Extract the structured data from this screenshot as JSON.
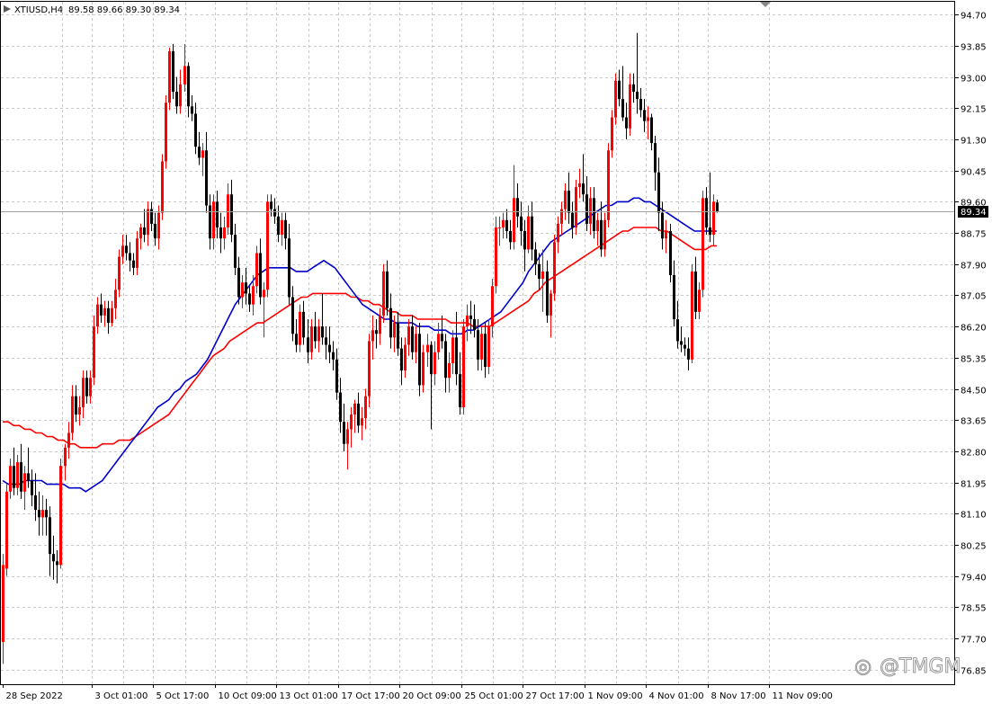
{
  "header": {
    "symbol": "XTIUSD,H4",
    "ohlc": "89.58 89.66 89.30 89.34"
  },
  "watermark": {
    "text": "@TMGM"
  },
  "colors": {
    "bull": "#ff0000",
    "bear": "#000000",
    "ma_fast": "#0000cc",
    "ma_slow": "#ff0000",
    "grid": "#c8c8c8",
    "price_marker_bg": "#000000",
    "price_marker_text": "#ffffff"
  },
  "chart_data": {
    "type": "candlestick",
    "symbol": "XTIUSD",
    "timeframe": "H4",
    "last_price": 89.34,
    "last_price_label": "89.34",
    "ylim": [
      76.45,
      95.05
    ],
    "grid": true,
    "y_ticks": [
      "94.70",
      "93.85",
      "93.00",
      "92.15",
      "91.30",
      "90.45",
      "89.60",
      "88.75",
      "87.90",
      "87.05",
      "86.20",
      "85.35",
      "84.50",
      "83.65",
      "82.80",
      "81.95",
      "81.10",
      "80.25",
      "79.40",
      "78.55",
      "77.70",
      "76.85"
    ],
    "x_ticks": [
      {
        "label": "28 Sep 2022",
        "index": 0
      },
      {
        "label": "3 Oct 01:00",
        "index": 17
      },
      {
        "label": "5 Oct 17:00",
        "index": 34
      },
      {
        "label": "10 Oct 09:00",
        "index": 51
      },
      {
        "label": "13 Oct 01:00",
        "index": 68
      },
      {
        "label": "17 Oct 17:00",
        "index": 85
      },
      {
        "label": "20 Oct 09:00",
        "index": 102
      },
      {
        "label": "25 Oct 01:00",
        "index": 119
      },
      {
        "label": "27 Oct 17:00",
        "index": 136
      },
      {
        "label": "1 Nov 09:00",
        "index": 153
      },
      {
        "label": "4 Nov 01:00",
        "index": 170
      },
      {
        "label": "8 Nov 17:00",
        "index": 187
      },
      {
        "label": "11 Nov 09:00",
        "index": 204
      }
    ],
    "ohlc": [
      [
        77.6,
        80.0,
        77.0,
        79.7
      ],
      [
        79.6,
        81.9,
        79.4,
        81.7
      ],
      [
        81.7,
        82.6,
        81.5,
        82.4
      ],
      [
        82.4,
        82.9,
        81.6,
        81.8
      ],
      [
        81.8,
        82.7,
        81.6,
        82.5
      ],
      [
        82.5,
        83.0,
        81.5,
        81.7
      ],
      [
        81.7,
        82.4,
        81.2,
        82.2
      ],
      [
        82.2,
        82.9,
        81.8,
        82.0
      ],
      [
        82.0,
        82.3,
        81.3,
        81.6
      ],
      [
        81.6,
        82.2,
        80.9,
        81.2
      ],
      [
        81.2,
        81.7,
        80.5,
        81.0
      ],
      [
        81.0,
        81.6,
        80.5,
        81.2
      ],
      [
        81.2,
        81.5,
        80.5,
        81.0
      ],
      [
        81.0,
        81.3,
        79.4,
        80.0
      ],
      [
        80.0,
        80.5,
        79.3,
        79.8
      ],
      [
        79.8,
        80.1,
        79.2,
        79.7
      ],
      [
        79.7,
        82.6,
        79.6,
        82.4
      ],
      [
        82.4,
        83.0,
        82.0,
        82.9
      ],
      [
        82.9,
        83.6,
        82.6,
        83.3
      ],
      [
        83.3,
        84.6,
        83.1,
        84.3
      ],
      [
        84.3,
        84.6,
        83.6,
        83.8
      ],
      [
        83.8,
        84.3,
        83.5,
        84.0
      ],
      [
        84.0,
        85.0,
        83.7,
        84.8
      ],
      [
        84.8,
        85.0,
        84.1,
        84.3
      ],
      [
        84.3,
        85.0,
        84.1,
        84.8
      ],
      [
        84.8,
        86.5,
        84.6,
        86.2
      ],
      [
        86.2,
        87.0,
        86.0,
        86.8
      ],
      [
        86.8,
        87.1,
        86.3,
        86.5
      ],
      [
        86.5,
        86.9,
        86.2,
        86.7
      ],
      [
        86.7,
        86.9,
        86.0,
        86.3
      ],
      [
        86.3,
        86.9,
        86.2,
        86.7
      ],
      [
        86.7,
        87.5,
        86.4,
        87.2
      ],
      [
        87.2,
        88.3,
        87.0,
        88.1
      ],
      [
        88.1,
        88.7,
        87.9,
        88.4
      ],
      [
        88.4,
        88.7,
        88.0,
        88.2
      ],
      [
        88.2,
        88.5,
        87.7,
        88.0
      ],
      [
        88.0,
        88.2,
        87.6,
        87.8
      ],
      [
        87.8,
        88.8,
        87.6,
        88.6
      ],
      [
        88.6,
        89.0,
        88.3,
        88.9
      ],
      [
        88.9,
        89.4,
        88.5,
        88.7
      ],
      [
        88.7,
        89.6,
        88.4,
        89.4
      ],
      [
        89.4,
        89.6,
        88.8,
        89.0
      ],
      [
        89.0,
        89.3,
        88.4,
        88.6
      ],
      [
        88.6,
        89.5,
        88.3,
        89.3
      ],
      [
        89.3,
        90.9,
        89.1,
        90.7
      ],
      [
        90.7,
        92.5,
        90.5,
        92.3
      ],
      [
        92.3,
        93.8,
        92.1,
        93.7
      ],
      [
        93.7,
        93.9,
        92.4,
        92.6
      ],
      [
        92.6,
        93.0,
        92.0,
        92.2
      ],
      [
        92.2,
        93.2,
        92.0,
        92.8
      ],
      [
        92.8,
        93.9,
        92.6,
        93.3
      ],
      [
        93.3,
        93.4,
        91.9,
        92.2
      ],
      [
        92.2,
        92.5,
        91.8,
        92.0
      ],
      [
        92.0,
        92.3,
        90.9,
        91.1
      ],
      [
        91.1,
        91.5,
        90.6,
        90.8
      ],
      [
        90.8,
        91.2,
        90.3,
        91.0
      ],
      [
        91.0,
        91.5,
        89.3,
        89.5
      ],
      [
        89.5,
        89.8,
        88.3,
        88.6
      ],
      [
        88.6,
        89.8,
        88.3,
        89.6
      ],
      [
        89.6,
        89.9,
        88.6,
        88.9
      ],
      [
        88.9,
        89.3,
        88.2,
        88.6
      ],
      [
        88.6,
        89.2,
        88.3,
        88.9
      ],
      [
        88.9,
        90.1,
        88.7,
        89.8
      ],
      [
        89.8,
        90.2,
        88.5,
        88.7
      ],
      [
        88.7,
        89.0,
        87.6,
        87.8
      ],
      [
        87.8,
        88.1,
        86.8,
        87.0
      ],
      [
        87.0,
        87.6,
        86.7,
        87.4
      ],
      [
        87.4,
        87.8,
        86.8,
        87.1
      ],
      [
        87.1,
        87.3,
        86.6,
        86.8
      ],
      [
        86.8,
        87.6,
        86.5,
        87.3
      ],
      [
        87.3,
        88.4,
        87.1,
        88.2
      ],
      [
        88.2,
        88.6,
        86.8,
        87.0
      ],
      [
        87.0,
        87.4,
        85.9,
        87.2
      ],
      [
        87.2,
        89.8,
        87.0,
        89.6
      ],
      [
        89.6,
        89.8,
        89.2,
        89.4
      ],
      [
        89.4,
        89.7,
        89.0,
        89.2
      ],
      [
        89.2,
        89.5,
        88.5,
        88.7
      ],
      [
        88.7,
        89.3,
        88.4,
        89.1
      ],
      [
        89.1,
        89.3,
        88.3,
        88.6
      ],
      [
        88.6,
        89.0,
        86.8,
        87.0
      ],
      [
        87.0,
        87.3,
        85.8,
        86.0
      ],
      [
        86.0,
        86.4,
        85.5,
        85.7
      ],
      [
        85.7,
        86.8,
        85.5,
        86.6
      ],
      [
        86.6,
        86.9,
        85.7,
        85.9
      ],
      [
        85.9,
        86.4,
        85.2,
        85.5
      ],
      [
        85.5,
        86.4,
        85.3,
        86.2
      ],
      [
        86.2,
        86.6,
        85.6,
        85.8
      ],
      [
        85.8,
        86.4,
        85.5,
        86.2
      ],
      [
        86.2,
        87.1,
        85.7,
        85.9
      ],
      [
        85.9,
        86.2,
        85.3,
        85.7
      ],
      [
        85.7,
        86.2,
        85.2,
        85.5
      ],
      [
        85.5,
        85.8,
        85.0,
        85.3
      ],
      [
        85.3,
        85.6,
        84.2,
        84.4
      ],
      [
        84.4,
        84.8,
        83.3,
        83.6
      ],
      [
        83.6,
        84.1,
        82.8,
        83.0
      ],
      [
        83.0,
        83.6,
        82.3,
        83.4
      ],
      [
        83.4,
        84.0,
        82.9,
        83.8
      ],
      [
        83.8,
        84.2,
        83.3,
        84.1
      ],
      [
        84.1,
        84.4,
        83.3,
        83.5
      ],
      [
        83.5,
        84.0,
        83.1,
        83.7
      ],
      [
        83.7,
        84.5,
        83.4,
        84.3
      ],
      [
        84.3,
        86.0,
        84.0,
        85.8
      ],
      [
        85.8,
        86.5,
        85.3,
        86.1
      ],
      [
        86.1,
        86.4,
        85.6,
        86.0
      ],
      [
        86.0,
        86.7,
        85.7,
        86.5
      ],
      [
        86.5,
        87.9,
        86.3,
        87.7
      ],
      [
        87.7,
        88.0,
        86.5,
        86.7
      ],
      [
        86.7,
        87.1,
        85.6,
        85.9
      ],
      [
        85.9,
        86.5,
        85.5,
        86.3
      ],
      [
        86.3,
        86.6,
        85.4,
        85.6
      ],
      [
        85.6,
        85.9,
        84.6,
        85.0
      ],
      [
        85.0,
        85.9,
        84.8,
        85.7
      ],
      [
        85.7,
        86.4,
        85.4,
        86.2
      ],
      [
        86.2,
        86.5,
        85.3,
        85.5
      ],
      [
        85.5,
        86.2,
        85.2,
        86.0
      ],
      [
        86.0,
        86.3,
        84.3,
        84.6
      ],
      [
        84.6,
        85.7,
        84.4,
        85.5
      ],
      [
        85.5,
        86.0,
        85.1,
        85.7
      ],
      [
        85.7,
        85.8,
        83.4,
        84.9
      ],
      [
        84.9,
        85.8,
        84.6,
        85.5
      ],
      [
        85.5,
        86.3,
        85.3,
        86.0
      ],
      [
        86.0,
        86.5,
        85.6,
        85.8
      ],
      [
        85.8,
        86.0,
        84.4,
        84.8
      ],
      [
        84.8,
        85.5,
        84.4,
        85.2
      ],
      [
        85.2,
        86.1,
        84.9,
        85.9
      ],
      [
        85.9,
        86.6,
        84.6,
        84.9
      ],
      [
        84.9,
        85.5,
        83.8,
        84.0
      ],
      [
        84.0,
        86.4,
        83.8,
        86.2
      ],
      [
        86.2,
        86.8,
        85.8,
        86.5
      ],
      [
        86.5,
        86.9,
        86.0,
        86.4
      ],
      [
        86.4,
        86.8,
        85.9,
        86.1
      ],
      [
        86.1,
        86.4,
        85.0,
        85.3
      ],
      [
        85.3,
        86.2,
        85.0,
        86.0
      ],
      [
        86.0,
        86.3,
        84.8,
        85.1
      ],
      [
        85.1,
        86.4,
        84.9,
        86.2
      ],
      [
        86.2,
        87.5,
        85.9,
        87.3
      ],
      [
        87.3,
        89.2,
        87.1,
        88.9
      ],
      [
        88.9,
        89.2,
        88.4,
        88.9
      ],
      [
        88.9,
        89.3,
        88.6,
        89.1
      ],
      [
        89.1,
        89.4,
        88.6,
        88.8
      ],
      [
        88.8,
        89.1,
        88.3,
        88.5
      ],
      [
        88.5,
        90.6,
        88.3,
        89.7
      ],
      [
        89.7,
        90.1,
        88.9,
        89.2
      ],
      [
        89.2,
        89.6,
        88.4,
        88.8
      ],
      [
        88.8,
        89.1,
        87.7,
        88.3
      ],
      [
        88.3,
        89.5,
        88.2,
        89.2
      ],
      [
        89.2,
        89.6,
        88.0,
        88.3
      ],
      [
        88.3,
        88.5,
        87.6,
        87.9
      ],
      [
        87.9,
        88.2,
        87.2,
        87.5
      ],
      [
        87.5,
        88.3,
        86.6,
        87.7
      ],
      [
        87.7,
        88.0,
        86.3,
        86.5
      ],
      [
        86.5,
        87.2,
        85.9,
        87.1
      ],
      [
        87.1,
        88.7,
        86.9,
        88.5
      ],
      [
        88.5,
        89.2,
        88.2,
        89.0
      ],
      [
        89.0,
        89.6,
        88.7,
        89.4
      ],
      [
        89.4,
        90.1,
        89.1,
        89.9
      ],
      [
        89.9,
        90.4,
        89.0,
        89.3
      ],
      [
        89.3,
        89.6,
        88.6,
        88.9
      ],
      [
        88.9,
        90.2,
        88.7,
        90.0
      ],
      [
        90.0,
        90.5,
        89.7,
        90.1
      ],
      [
        90.1,
        90.9,
        89.6,
        89.8
      ],
      [
        89.8,
        90.3,
        88.8,
        89.0
      ],
      [
        89.0,
        90.0,
        88.7,
        89.7
      ],
      [
        89.7,
        90.0,
        88.6,
        88.8
      ],
      [
        88.8,
        89.3,
        88.4,
        89.1
      ],
      [
        89.1,
        89.6,
        88.1,
        88.3
      ],
      [
        88.3,
        89.3,
        88.1,
        89.1
      ],
      [
        89.1,
        91.2,
        88.9,
        91.0
      ],
      [
        91.0,
        92.1,
        90.8,
        91.9
      ],
      [
        91.9,
        93.1,
        91.7,
        92.9
      ],
      [
        92.9,
        93.2,
        92.2,
        92.4
      ],
      [
        92.4,
        93.3,
        91.8,
        91.9
      ],
      [
        91.9,
        92.3,
        91.3,
        91.6
      ],
      [
        91.6,
        93.1,
        91.4,
        92.8
      ],
      [
        92.8,
        93.1,
        92.3,
        92.6
      ],
      [
        92.6,
        94.2,
        92.0,
        92.4
      ],
      [
        92.4,
        92.7,
        91.9,
        92.1
      ],
      [
        92.1,
        92.4,
        91.5,
        91.8
      ],
      [
        91.8,
        92.2,
        91.3,
        91.9
      ],
      [
        91.9,
        92.0,
        91.0,
        91.2
      ],
      [
        91.2,
        91.4,
        89.9,
        90.4
      ],
      [
        90.4,
        90.8,
        88.8,
        89.3
      ],
      [
        89.3,
        89.6,
        88.3,
        88.6
      ],
      [
        88.6,
        89.1,
        88.2,
        88.8
      ],
      [
        88.8,
        89.0,
        87.4,
        87.6
      ],
      [
        87.6,
        88.0,
        86.2,
        86.4
      ],
      [
        86.4,
        86.9,
        85.6,
        85.8
      ],
      [
        85.8,
        86.2,
        85.5,
        85.7
      ],
      [
        85.7,
        85.9,
        85.4,
        85.6
      ],
      [
        85.6,
        85.9,
        85.0,
        85.3
      ],
      [
        85.3,
        87.9,
        85.2,
        87.7
      ],
      [
        87.7,
        88.1,
        86.4,
        86.6
      ],
      [
        86.6,
        87.4,
        86.4,
        87.2
      ],
      [
        87.2,
        89.9,
        87.0,
        89.7
      ],
      [
        89.7,
        90.0,
        88.7,
        88.9
      ],
      [
        88.9,
        90.4,
        88.5,
        88.7
      ],
      [
        88.7,
        89.8,
        88.4,
        89.6
      ],
      [
        89.58,
        89.66,
        89.3,
        89.34
      ]
    ],
    "ma_fast": [
      82.0,
      81.9,
      81.9,
      81.9,
      82.0,
      82.0,
      82.0,
      82.0,
      81.9,
      81.9,
      81.9,
      81.9,
      81.8,
      81.8,
      81.8,
      81.7,
      81.8,
      81.9,
      82.0,
      82.2,
      82.4,
      82.6,
      82.8,
      83.0,
      83.2,
      83.4,
      83.6,
      83.8,
      84.0,
      84.1,
      84.2,
      84.4,
      84.5,
      84.7,
      84.8,
      84.9,
      85.1,
      85.3,
      85.6,
      85.9,
      86.2,
      86.5,
      86.8,
      87.0,
      87.2,
      87.4,
      87.6,
      87.7,
      87.8,
      87.8,
      87.8,
      87.8,
      87.8,
      87.7,
      87.7,
      87.7,
      87.8,
      87.9,
      88.0,
      87.9,
      87.8,
      87.6,
      87.4,
      87.2,
      87.0,
      86.8,
      86.7,
      86.6,
      86.5,
      86.4,
      86.4,
      86.3,
      86.3,
      86.3,
      86.3,
      86.2,
      86.2,
      86.2,
      86.1,
      86.1,
      86.1,
      86.0,
      86.0,
      86.0,
      86.1,
      86.1,
      86.2,
      86.3,
      86.4,
      86.5,
      86.6,
      86.8,
      87.0,
      87.2,
      87.4,
      87.7,
      87.9,
      88.1,
      88.3,
      88.5,
      88.6,
      88.7,
      88.8,
      88.9,
      89.0,
      89.1,
      89.2,
      89.3,
      89.4,
      89.5,
      89.5,
      89.6,
      89.6,
      89.6,
      89.7,
      89.7,
      89.6,
      89.6,
      89.5,
      89.4,
      89.3,
      89.2,
      89.1,
      89.0,
      88.9,
      88.8,
      88.8,
      88.8,
      88.8,
      88.8
    ],
    "ma_slow": [
      83.6,
      83.6,
      83.5,
      83.5,
      83.4,
      83.4,
      83.3,
      83.3,
      83.2,
      83.2,
      83.1,
      83.1,
      83.0,
      83.0,
      82.9,
      82.9,
      82.9,
      82.9,
      83.0,
      83.0,
      83.0,
      83.1,
      83.1,
      83.1,
      83.2,
      83.3,
      83.4,
      83.5,
      83.6,
      83.7,
      83.8,
      84.0,
      84.2,
      84.4,
      84.6,
      84.8,
      85.0,
      85.2,
      85.4,
      85.5,
      85.6,
      85.8,
      85.9,
      86.0,
      86.1,
      86.2,
      86.3,
      86.3,
      86.4,
      86.5,
      86.6,
      86.7,
      86.8,
      86.9,
      87.0,
      87.0,
      87.1,
      87.1,
      87.1,
      87.1,
      87.1,
      87.1,
      87.1,
      87.0,
      87.0,
      86.9,
      86.9,
      86.8,
      86.8,
      86.7,
      86.6,
      86.6,
      86.5,
      86.5,
      86.5,
      86.4,
      86.4,
      86.4,
      86.4,
      86.4,
      86.4,
      86.3,
      86.3,
      86.3,
      86.3,
      86.2,
      86.2,
      86.2,
      86.2,
      86.3,
      86.4,
      86.5,
      86.6,
      86.7,
      86.8,
      86.9,
      87.1,
      87.2,
      87.4,
      87.5,
      87.6,
      87.7,
      87.8,
      87.9,
      88.0,
      88.1,
      88.2,
      88.3,
      88.4,
      88.5,
      88.6,
      88.7,
      88.8,
      88.8,
      88.9,
      88.9,
      88.9,
      88.9,
      88.9,
      88.8,
      88.8,
      88.7,
      88.6,
      88.5,
      88.4,
      88.3,
      88.3,
      88.3,
      88.4,
      88.4
    ]
  }
}
